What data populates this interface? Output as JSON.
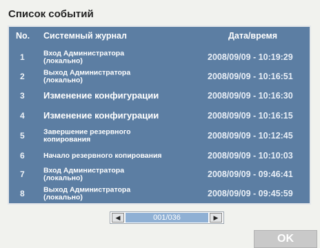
{
  "title": "Список событий",
  "columns": {
    "no": "No.",
    "event": "Системный журнал",
    "datetime": "Дата/время"
  },
  "rows": [
    {
      "no": "1",
      "event": "Вход Администратора (локально)",
      "datetime": "2008/09/09 - 10:19:29"
    },
    {
      "no": "2",
      "event": "Выход Администратора (локально)",
      "datetime": "2008/09/09 - 10:16:51"
    },
    {
      "no": "3",
      "event": "Изменение конфигурации",
      "datetime": "2008/09/09 - 10:16:30"
    },
    {
      "no": "4",
      "event": "Изменение конфигурации",
      "datetime": "2008/09/09 - 10:16:15"
    },
    {
      "no": "5",
      "event": "Завершение резервного копирования",
      "datetime": "2008/09/09 - 10:12:45"
    },
    {
      "no": "6",
      "event": "Начало резервного копирования",
      "datetime": "2008/09/09 - 10:10:03"
    },
    {
      "no": "7",
      "event": "Вход Администратора (локально)",
      "datetime": "2008/09/09 - 09:46:41"
    },
    {
      "no": "8",
      "event": "Выход Администратора (локально)",
      "datetime": "2008/09/09 - 09:45:59"
    }
  ],
  "pager": {
    "value": "001/036"
  },
  "ok_label": "OK",
  "colors": {
    "panel": "#5c7ea3",
    "pager_value": "#8fb0d4",
    "ok_button": "#c9c9c9"
  }
}
